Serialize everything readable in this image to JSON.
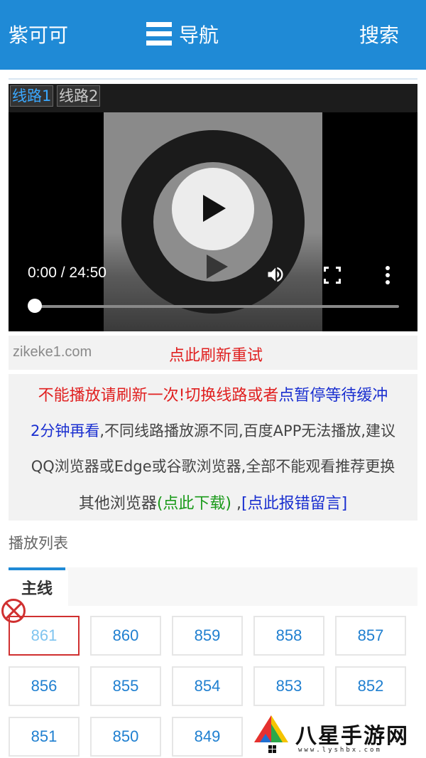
{
  "header": {
    "title": "紫可可",
    "nav_label": "导航",
    "search_label": "搜索",
    "bg_color": "#1f8ad6"
  },
  "player": {
    "line_tabs": [
      "线路1",
      "线路2"
    ],
    "active_line": 0,
    "time_current": "0:00",
    "time_separator": "/",
    "time_total": "24:50",
    "progress": 0
  },
  "refresh_bar": {
    "domain": "zikeke1.com",
    "refresh_text": "点此刷新重试"
  },
  "notice": {
    "line1_red": "不能播放请刷新一次!切换线路或者",
    "line1_blue": "点暂停等待缓冲",
    "line2_blue": "2分钟再看",
    "line2_rest": ",不同线路播放源不同,百度APP无法播放,建议",
    "line3": "QQ浏览器或Edge或谷歌浏览器,全部不能观看推荐更换",
    "line4_prefix": "其他浏览器",
    "download_link": "(点此下载)",
    "sep": " ,",
    "report_link": "[点此报错留言]"
  },
  "playlist": {
    "section_title": "播放列表",
    "tab_label": "主线",
    "episodes": [
      "861",
      "860",
      "859",
      "858",
      "857",
      "856",
      "855",
      "854",
      "853",
      "852",
      "851",
      "850",
      "849"
    ],
    "selected": "861"
  },
  "watermark": {
    "name": "八星手游网",
    "url": "www.lyshbx.com"
  }
}
